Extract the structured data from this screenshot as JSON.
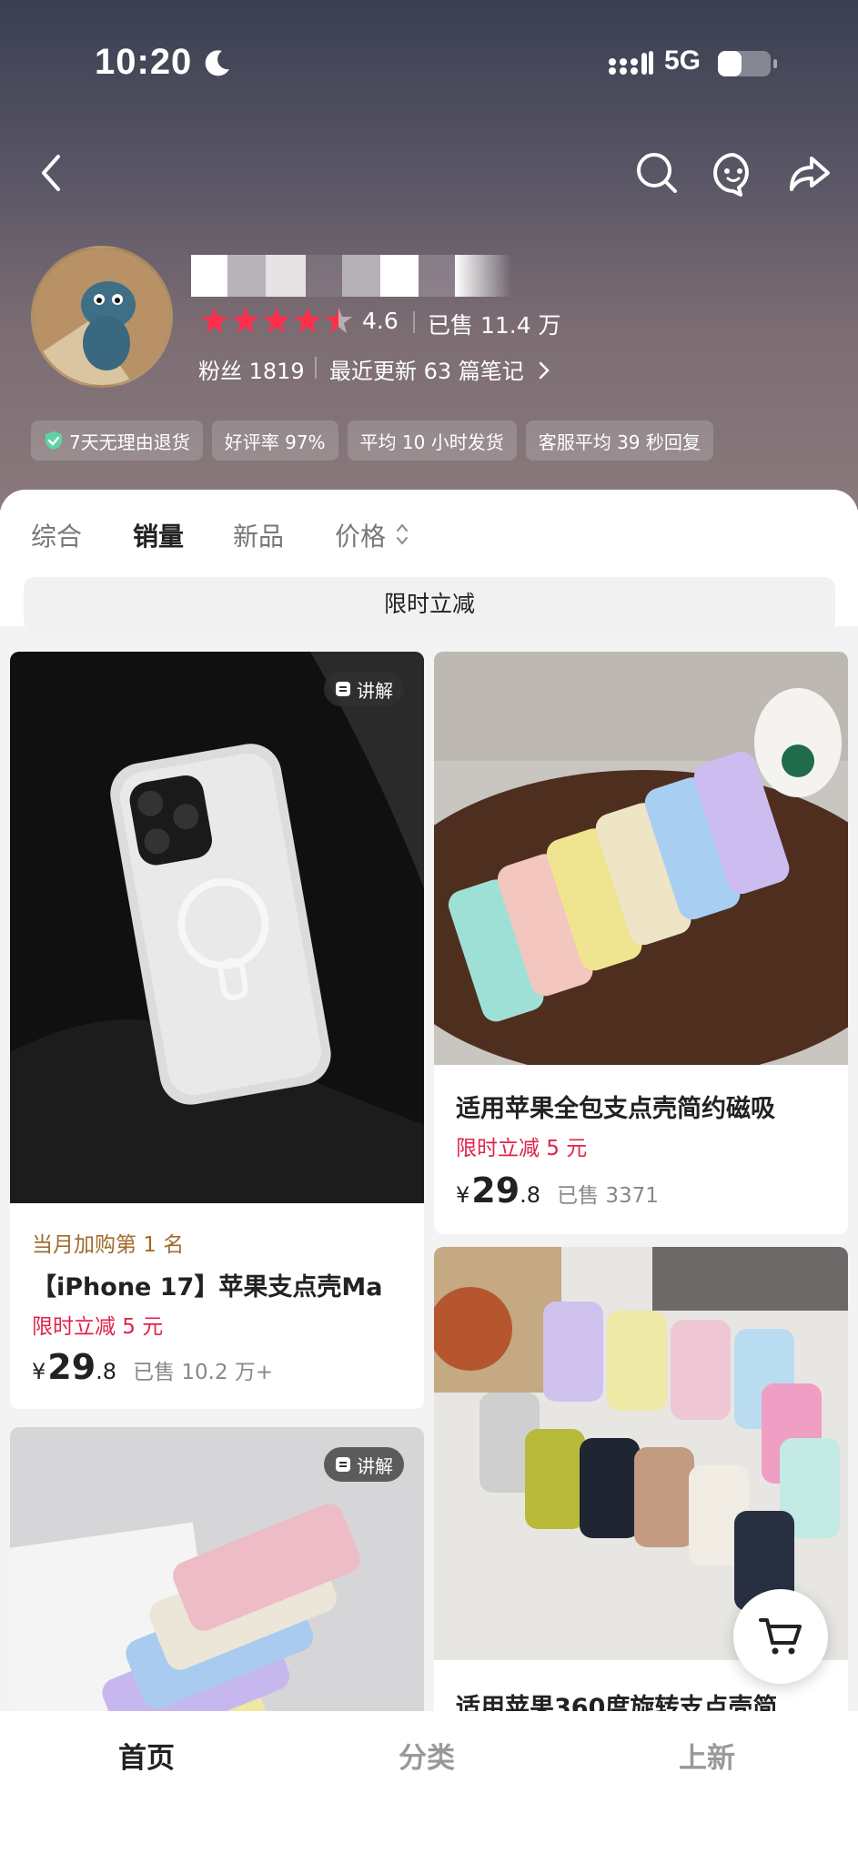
{
  "status_bar": {
    "time": "10:20",
    "network": "5G"
  },
  "shop": {
    "rating": "4.6",
    "rating_stars": 4.5,
    "sold": "已售 11.4 万",
    "fans": "粉丝 1819",
    "notes": "最近更新 63 篇笔记",
    "service_tags": [
      "7天无理由退货",
      "好评率 97%",
      "平均 10 小时发货",
      "客服平均 39 秒回复"
    ]
  },
  "sort_tabs": [
    "综合",
    "销量",
    "新品",
    "价格"
  ],
  "active_sort_tab": "销量",
  "promo_bar": "限时立减",
  "products": [
    {
      "badge": "讲解",
      "rank": "当月加购第 1 名",
      "title": "【iPhone 17】苹果支点壳Ma",
      "promo": "限时立减 5 元",
      "price_currency": "¥",
      "price_int": "29",
      "price_dec": ".8",
      "sold": "已售 10.2 万+"
    },
    {
      "title": "适用苹果全包支点壳简约磁吸",
      "promo": "限时立减 5 元",
      "price_currency": "¥",
      "price_int": "29",
      "price_dec": ".8",
      "sold": "已售 3371"
    },
    {
      "badge": "讲解"
    },
    {
      "title": "适用苹果360度旋转支点壳简"
    }
  ],
  "bottom_nav": [
    "首页",
    "分类",
    "上新"
  ],
  "active_bottom_nav": "首页",
  "colors": {
    "accent_red": "#e0234a",
    "rank_gold": "#a06b2d",
    "star_red": "#ff2e4d"
  }
}
